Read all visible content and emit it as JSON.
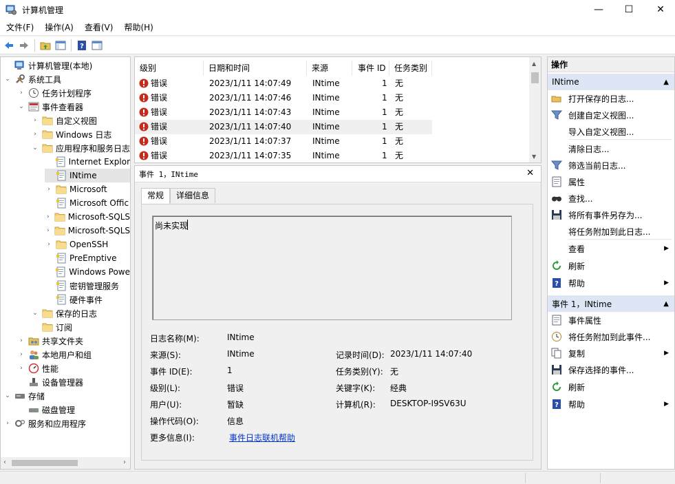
{
  "window": {
    "title": "计算机管理",
    "minimize": "—",
    "maximize": "☐",
    "close": "✕"
  },
  "menu": [
    "文件(F)",
    "操作(A)",
    "查看(V)",
    "帮助(H)"
  ],
  "tree": {
    "items": [
      {
        "label": "计算机管理(本地)"
      },
      {
        "label": "系统工具"
      },
      {
        "label": "任务计划程序"
      },
      {
        "label": "事件查看器"
      },
      {
        "label": "自定义视图"
      },
      {
        "label": "Windows 日志"
      },
      {
        "label": "应用程序和服务日志"
      },
      {
        "label": "Internet Explor"
      },
      {
        "label": "INtime"
      },
      {
        "label": "Microsoft"
      },
      {
        "label": "Microsoft Offic"
      },
      {
        "label": "Microsoft-SQLS"
      },
      {
        "label": "Microsoft-SQLS"
      },
      {
        "label": "OpenSSH"
      },
      {
        "label": "PreEmptive"
      },
      {
        "label": "Windows Powe"
      },
      {
        "label": "密钥管理服务"
      },
      {
        "label": "硬件事件"
      },
      {
        "label": "保存的日志"
      },
      {
        "label": "订阅"
      },
      {
        "label": "共享文件夹"
      },
      {
        "label": "本地用户和组"
      },
      {
        "label": "性能"
      },
      {
        "label": "设备管理器"
      },
      {
        "label": "存储"
      },
      {
        "label": "磁盘管理"
      },
      {
        "label": "服务和应用程序"
      }
    ]
  },
  "events": {
    "columns": [
      "级别",
      "日期和时间",
      "来源",
      "事件 ID",
      "任务类别"
    ],
    "rows": [
      {
        "level": "错误",
        "datetime": "2023/1/11 14:07:49",
        "source": "INtime",
        "id": "1",
        "category": "无"
      },
      {
        "level": "错误",
        "datetime": "2023/1/11 14:07:46",
        "source": "INtime",
        "id": "1",
        "category": "无"
      },
      {
        "level": "错误",
        "datetime": "2023/1/11 14:07:43",
        "source": "INtime",
        "id": "1",
        "category": "无"
      },
      {
        "level": "错误",
        "datetime": "2023/1/11 14:07:40",
        "source": "INtime",
        "id": "1",
        "category": "无"
      },
      {
        "level": "错误",
        "datetime": "2023/1/11 14:07:37",
        "source": "INtime",
        "id": "1",
        "category": "无"
      },
      {
        "level": "错误",
        "datetime": "2023/1/11 14:07:35",
        "source": "INtime",
        "id": "1",
        "category": "无"
      }
    ]
  },
  "detail": {
    "title": "事件 1，INtime",
    "close": "✕",
    "tabs": [
      "常规",
      "详细信息"
    ],
    "description": "尚未实现",
    "fields": {
      "log_name_label": "日志名称(M):",
      "log_name": "INtime",
      "source_label": "来源(S):",
      "source": "INtime",
      "logged_label": "记录时间(D):",
      "logged": "2023/1/11 14:07:40",
      "event_id_label": "事件 ID(E):",
      "event_id": "1",
      "task_label": "任务类别(Y):",
      "task": "无",
      "level_label": "级别(L):",
      "level": "错误",
      "keywords_label": "关键字(K):",
      "keywords": "经典",
      "user_label": "用户(U):",
      "user": "暂缺",
      "computer_label": "计算机(R):",
      "computer": "DESKTOP-I9SV63U",
      "opcode_label": "操作代码(O):",
      "opcode": "信息",
      "more_label": "更多信息(I):",
      "more_link": "事件日志联机帮助"
    }
  },
  "actions": {
    "header": "操作",
    "section1": "INtime",
    "items1": [
      "打开保存的日志...",
      "创建自定义视图...",
      "导入自定义视图...",
      "清除日志...",
      "筛选当前日志...",
      "属性",
      "查找...",
      "将所有事件另存为...",
      "将任务附加到此日志...",
      "查看",
      "刷新",
      "帮助"
    ],
    "section2": "事件 1，INtime",
    "items2": [
      "事件属性",
      "将任务附加到此事件...",
      "复制",
      "保存选择的事件...",
      "刷新",
      "帮助"
    ]
  },
  "colors": {
    "accent": "#0078d7",
    "error": "#c42b1c",
    "selected_section": "#dce6f4",
    "link": "#0033cc"
  }
}
